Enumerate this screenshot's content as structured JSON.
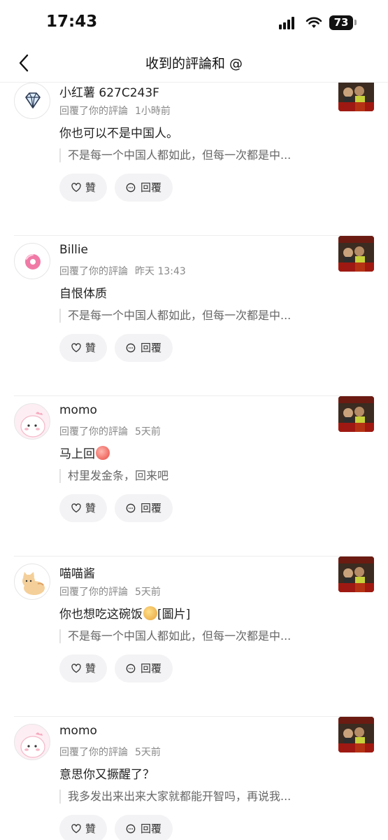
{
  "status_bar": {
    "time": "17:43",
    "battery": "73"
  },
  "header": {
    "title": "收到的評論和 @",
    "back_icon": "chevron-left-icon"
  },
  "items": [
    {
      "username": "小红薯 627C243F",
      "action": "回覆了你的評論",
      "time": "1小時前",
      "reply": "你也可以不是中国人。",
      "reply_image_tag": "",
      "quote": "不是每一个中国人都如此，但每一次都是中...",
      "like_label": "贊",
      "reply_label": "回覆",
      "avatar_icon": "diamond-icon"
    },
    {
      "username": "Billie",
      "action": "回覆了你的評論",
      "time": "昨天 13:43",
      "reply": "自恨体质",
      "reply_image_tag": "",
      "quote": "不是每一个中国人都如此，但每一次都是中...",
      "like_label": "贊",
      "reply_label": "回覆",
      "avatar_icon": "donut-icon"
    },
    {
      "username": "momo",
      "action": "回覆了你的評論",
      "time": "5天前",
      "reply": "马上回",
      "reply_image_tag": "",
      "quote": "村里发金条，回来吧",
      "like_label": "贊",
      "reply_label": "回覆",
      "avatar_icon": "pink-blob-avatar"
    },
    {
      "username": "喵喵酱",
      "action": "回覆了你的評論",
      "time": "5天前",
      "reply": "你也想吃这碗饭",
      "reply_image_tag": "[圖片]",
      "quote": "不是每一个中国人都如此，但每一次都是中...",
      "like_label": "贊",
      "reply_label": "回覆",
      "avatar_icon": "cat-avatar"
    },
    {
      "username": "momo",
      "action": "回覆了你的評論",
      "time": "5天前",
      "reply": "意思你又撅醒了？",
      "reply_image_tag": "",
      "quote": "我多发出来出来大家就都能开智吗，再说我...",
      "like_label": "贊",
      "reply_label": "回覆",
      "avatar_icon": "pink-blob-avatar"
    }
  ],
  "colors": {
    "button_bg": "#f3f3f5",
    "divider": "#ededed",
    "meta_text": "#888888"
  }
}
